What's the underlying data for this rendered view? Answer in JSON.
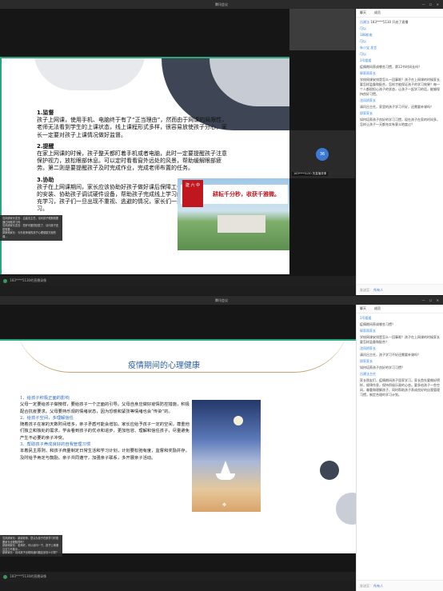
{
  "window_title": "腾讯会议",
  "window_controls": "— ☐ ✕",
  "top": {
    "thumb_label": "",
    "live_number": "36",
    "live_label": "183****5130 的直播录像",
    "status_label": "183****5130的直播录像",
    "slide": {
      "sections": [
        {
          "heading": "1.监督",
          "body": "孩子上网课，使用手机、电脑终于有了“正当理由”，然而由于网课的局限性，老师无法看到学生的上课状态，线上课程形式多样，很容易放使孩子分心，家长一定要对孩子上课情况做好监督。"
        },
        {
          "heading": "2.提醒",
          "body": "在家上网课的时候，孩子整天都盯着手机或者电脑，此时一定要提醒孩子注意保护视力，放松眼部休息。可以定时看看窗外远处的风景，帮助缓解眼部疲劳。第二则是要提醒孩子及时完成作业，完成老师布置的任务。"
        },
        {
          "heading": "3.协助",
          "body": "孩子在上网课期间，家长应该协助好孩子做好课后保障工作。比如，上课软件的安装、协助孩子调试硬件设备，帮助孩子完成线上学习的任务，是假期内补充学习，孩子们一旦出现不重视、逃避的情况，家长们一要求孩子正常进行学习。"
        }
      ],
      "image_seal": "建 六 中",
      "image_banner": "耕耘千分秒，收获千雅微。"
    },
    "chat_overlay": [
      "沈凤娇家长发言：吕建法主任，请问孩子假期需要通过网络学习吗",
      "沈凤娇家长发言：您好可爱的回答了，请问孩子还是需要...",
      "郭家雨家长：今天老师读的孩子心理健康方面的课..."
    ],
    "sidebar": {
      "tabs": [
        "聊天",
        "成员"
      ],
      "invite": "邀请成员",
      "lines": [
        {
          "who": "吕建法",
          "text": "183****5130 开启了直播"
        },
        {
          "who": "系统",
          "text": "可以"
        },
        {
          "who": "",
          "text": "188机电"
        },
        {
          "who": "",
          "text": "可以"
        },
        {
          "who": "",
          "text": "朱小宝 发言"
        },
        {
          "who": "",
          "text": "可以"
        },
        {
          "who": "",
          "text": "1号姐姐"
        },
        {
          "who": "",
          "text": "疫情期间养成哪些习惯，第12节时间长吗？"
        },
        {
          "who": "",
          "text": "郭家雨家长"
        },
        {
          "who": "",
          "text": "学校网课安排是怎么一回事呢？孩子在上网课的时候家长要怎样监督和配合，怎样才能保证孩子的学习效果？每一个人都很担心孩子的状态，让孩子一起学习的话，能够保持良好习惯。"
        },
        {
          "who": "",
          "text": "沈凤娇家长"
        },
        {
          "who": "",
          "text": "请问吕主任，家里的孩子学习不好，还需要补课吗？"
        },
        {
          "who": "",
          "text": "邵家家长"
        },
        {
          "who": "",
          "text": "如何培养孩子良好的学习习惯，现在孩子在家的时间多，怎样让孩子一天都充实有意义地度过？"
        }
      ],
      "input_to": "发送至：",
      "input_to_value": "所有人",
      "input_placeholder": ""
    }
  },
  "bottom": {
    "live_label": "183****5130 的直播录像",
    "status_label": "183****5130的直播录像",
    "slide": {
      "title": "疫情期间的心理健康",
      "items": [
        {
          "heading": "1、给孩子积极正面的影响",
          "body": "父母一定要给孩子做榜样，要给孩子一个正面的引导。父母自身应做好疫情防控措施，积极配合抗疫要求。父母要持乐观的情绪状态，因为恐慌和紧张等情绪也会“传染”的。"
        },
        {
          "heading": "2、给孩子空间，多理解信任",
          "body": "随着孩子在家的天数时间增多，亲子矛盾可能会增加。家长应给予孩子一定的空间，尊重他们独立和独处的需求，学会看到孩子的优点和进步，更加包容、理解和信任孩子，尽量避免产生不必要的亲子冲突。"
        },
        {
          "heading": "3、帮助孩子养成良好的自我管理习惯",
          "body": "本着民主原则，和孩子商量制定日常生活和学习计划，计划要松弛有度，监督和奖励并存，及时给予肯定与鼓励。亲子共同遵守，加强亲子联系，多开展亲子活动。"
        }
      ]
    },
    "chat_overlay": [
      "沈凤娇家长：谢谢老师，您认为孩子在家学习时需要家长全程陪同吗？",
      "郭家雨家长：老师好，可以请问一下，孩子上网课注意力不集中...",
      "邵家家长：请问孩子出现情绪问题应该怎么引导？"
    ],
    "sidebar": {
      "tabs": [
        "聊天",
        "成员"
      ],
      "lines": [
        {
          "who": "",
          "text": "1号姐姐"
        },
        {
          "who": "",
          "text": "疫情期间养成哪些习惯？"
        },
        {
          "who": "",
          "text": "郭家雨家长"
        },
        {
          "who": "",
          "text": "学校网课安排是怎么一回事呢？孩子在上网课的时候家长要怎样监督和配合？"
        },
        {
          "who": "",
          "text": "沈凤娇家长"
        },
        {
          "who": "",
          "text": "请问吕主任，孩子学习不好还需要补课吗？"
        },
        {
          "who": "",
          "text": "邵家家长"
        },
        {
          "who": "",
          "text": "如何培养孩子良好的学习习惯？"
        },
        {
          "who": "",
          "text": "吕建法主任"
        },
        {
          "who": "",
          "text": "家长朋友们，疫情期间孩子居家学习，家长首先要做好榜样，规律作息，保持积极乐观的心态。要多给孩子一些空间，尊重和理解孩子，同时帮助孩子养成良好的自我管理习惯，制定合理的学习计划。"
        }
      ],
      "input_to": "发送至：",
      "input_to_value": "所有人"
    }
  },
  "colors": {
    "accent": "#2ba57c",
    "link": "#3b7bd6",
    "slide_title": "#2c5fa3",
    "heading_blue": "#2c6ac5"
  }
}
